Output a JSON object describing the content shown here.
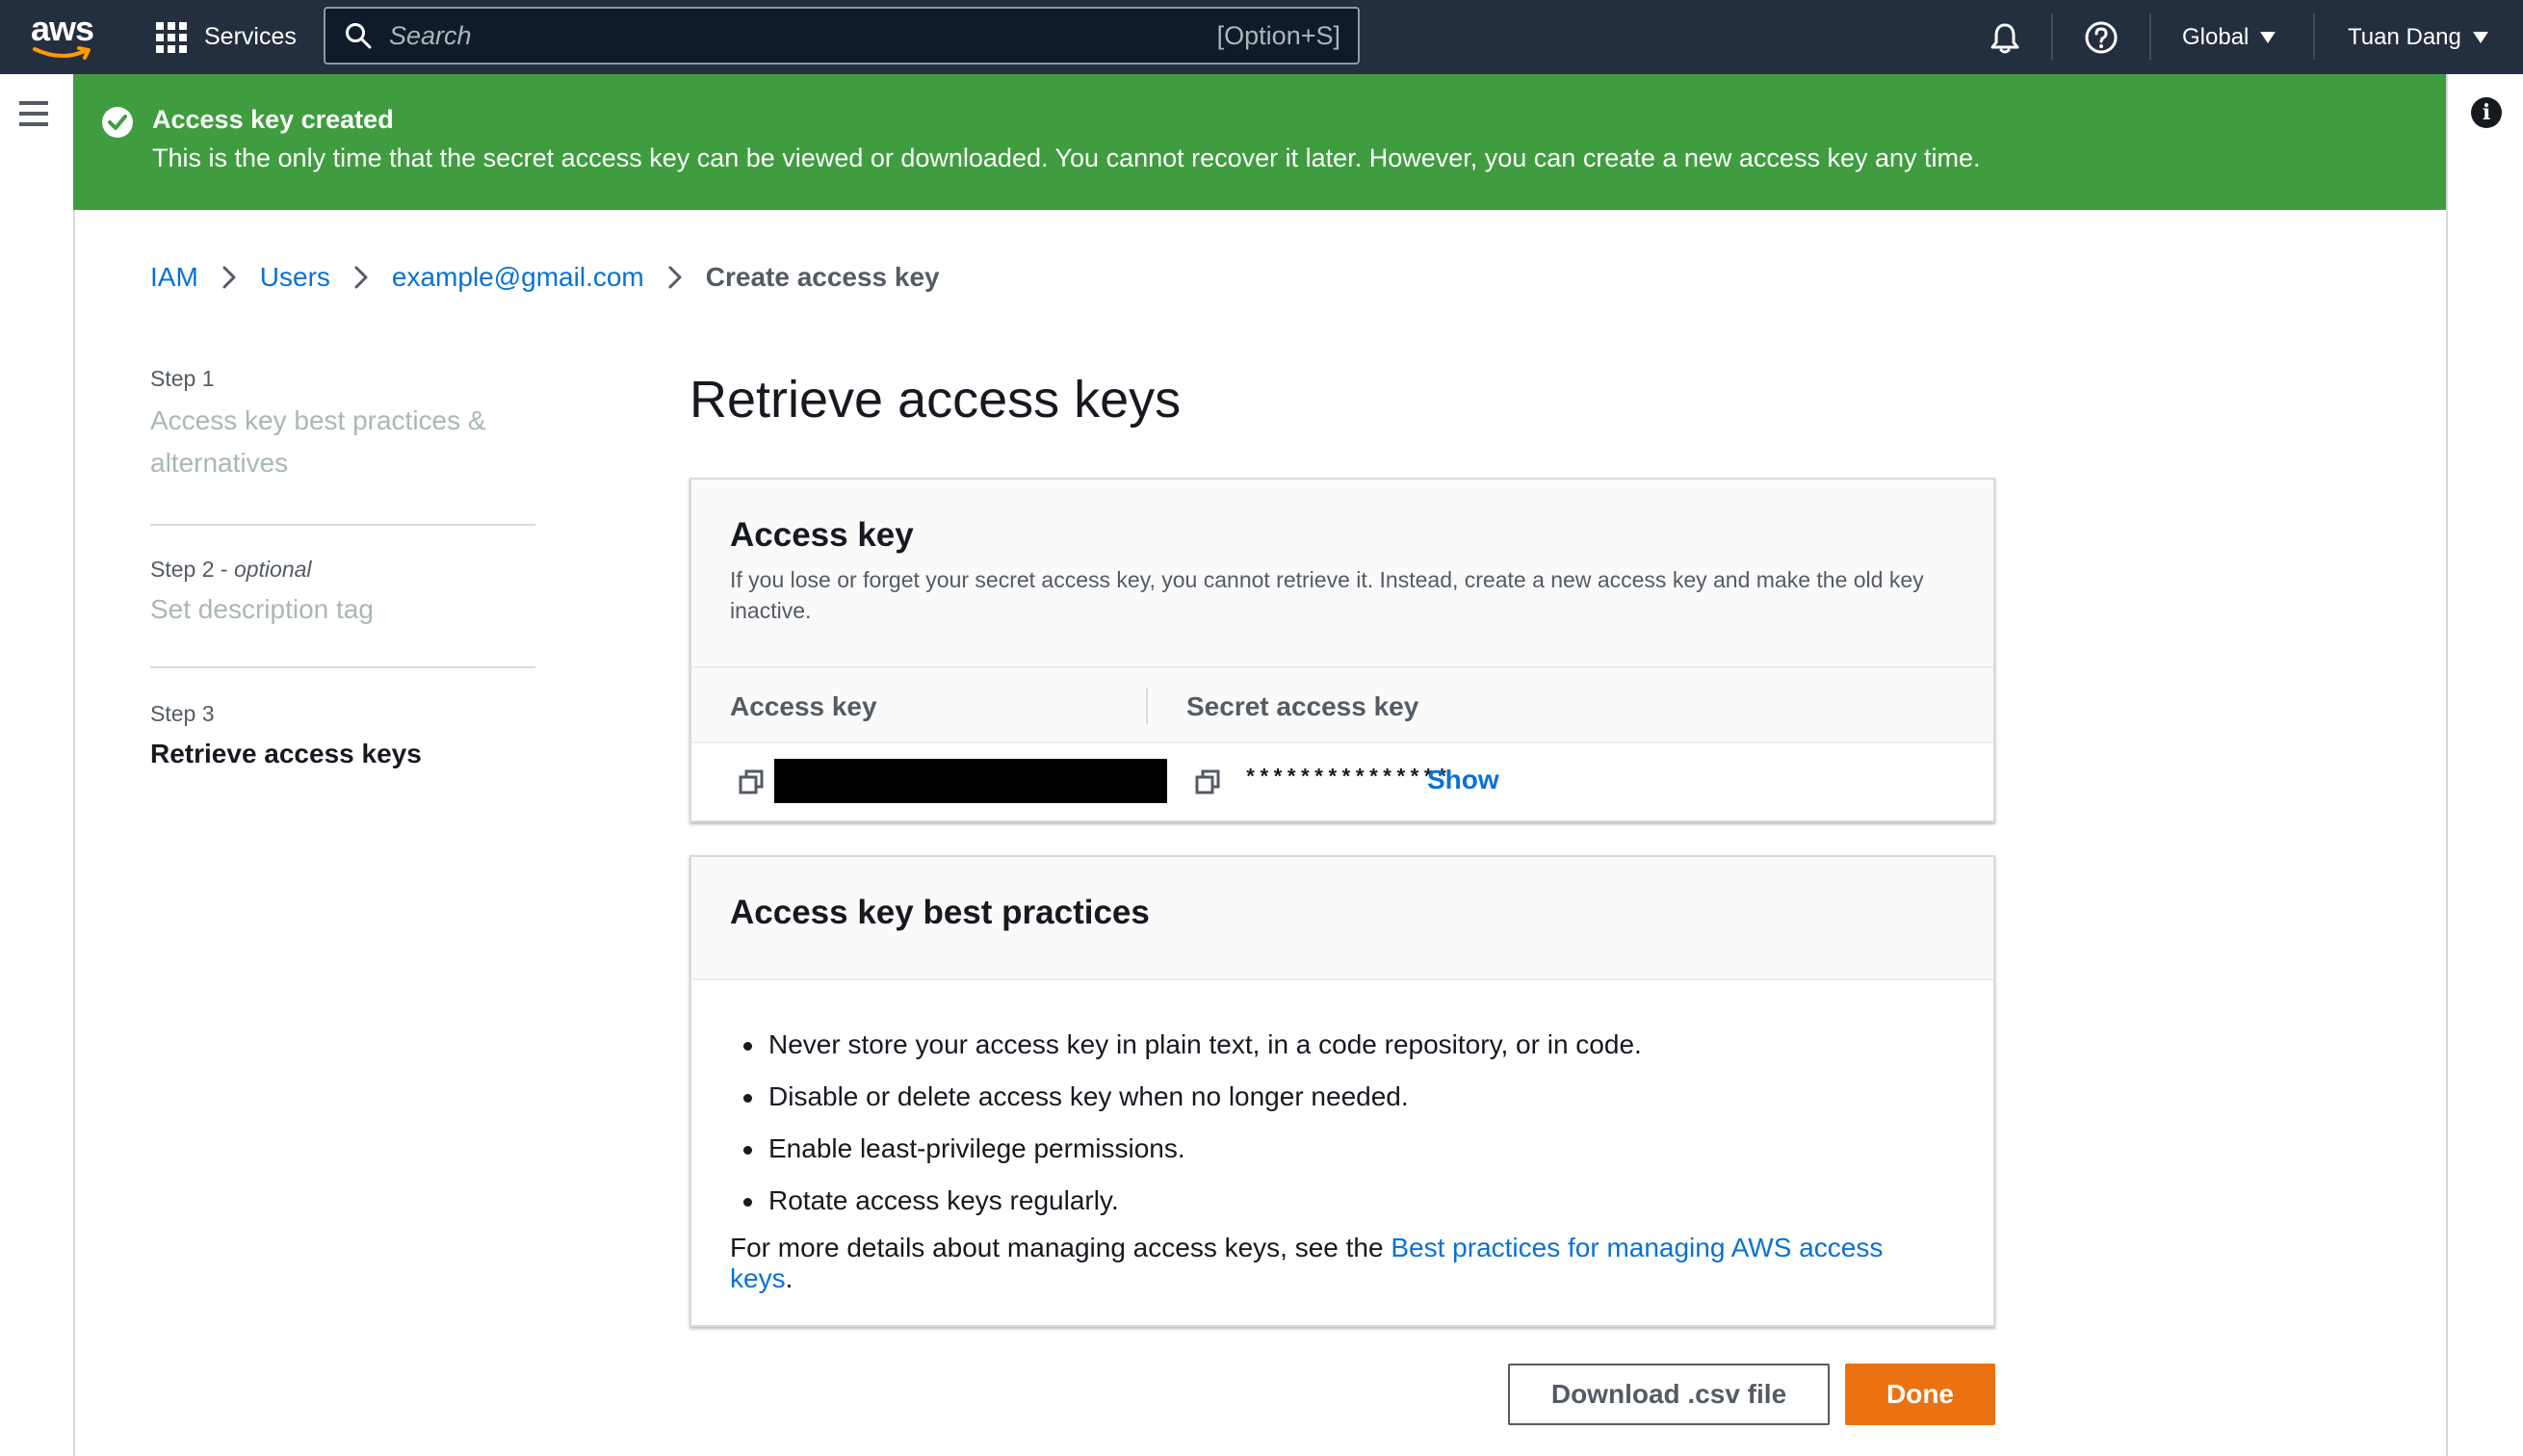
{
  "nav": {
    "logo_text": "aws",
    "services_label": "Services",
    "search_placeholder": "Search",
    "search_shortcut": "[Option+S]",
    "region": "Global",
    "user": "Tuan Dang"
  },
  "flash": {
    "title": "Access key created",
    "message": "This is the only time that the secret access key can be viewed or downloaded. You cannot recover it later. However, you can create a new access key any time."
  },
  "breadcrumb": {
    "items": [
      "IAM",
      "Users",
      "example@gmail.com"
    ],
    "current": "Create access key"
  },
  "steps": [
    {
      "num": "Step 1",
      "title": "Access key best practices & alternatives"
    },
    {
      "num": "Step 2",
      "optional": "optional",
      "title": "Set description tag"
    },
    {
      "num": "Step 3",
      "title": "Retrieve access keys"
    }
  ],
  "main": {
    "title": "Retrieve access keys",
    "access_key_panel": {
      "title": "Access key",
      "description": "If you lose or forget your secret access key, you cannot retrieve it. Instead, create a new access key and make the old key inactive.",
      "col_access_key": "Access key",
      "col_secret_key": "Secret access key",
      "secret_masked": "***************",
      "show_label": "Show"
    },
    "best_practices_panel": {
      "title": "Access key best practices",
      "items": [
        "Never store your access key in plain text, in a code repository, or in code.",
        "Disable or delete access key when no longer needed.",
        "Enable least-privilege permissions.",
        "Rotate access keys regularly."
      ],
      "more_prefix": "For more details about managing access keys, see the ",
      "more_link": "Best practices for managing AWS access keys",
      "more_suffix": "."
    },
    "buttons": {
      "download": "Download .csv file",
      "done": "Done"
    }
  },
  "colors": {
    "nav_bg": "#232f3e",
    "success": "#3f9c3f",
    "link": "#0972d3",
    "primary_button": "#ec7211"
  }
}
